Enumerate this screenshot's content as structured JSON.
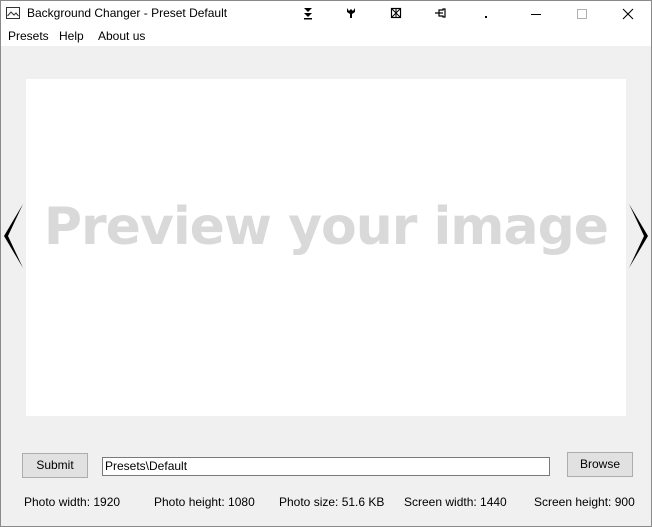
{
  "window": {
    "title": "Background Changer - Preset Default"
  },
  "titlebar_icons": [
    "double-chevron-down-icon",
    "wrench-icon",
    "grid-icon",
    "pin-icon",
    "dot-icon"
  ],
  "menu": {
    "items": [
      {
        "label": "Presets"
      },
      {
        "label": "Help"
      },
      {
        "label": "About us"
      }
    ]
  },
  "preview": {
    "placeholder": "Preview your image"
  },
  "controls": {
    "submit_label": "Submit",
    "path_value": "Presets\\Default",
    "browse_label": "Browse"
  },
  "status": {
    "photo_width": "Photo width: 1920",
    "photo_height": "Photo height: 1080",
    "photo_size": "Photo size: 51.6 KB",
    "screen_width": "Screen width: 1440",
    "screen_height": "Screen height: 900"
  },
  "colors": {
    "window_bg": "#f0f0f0",
    "preview_bg": "#ffffff",
    "placeholder_text": "#d9d9d9",
    "button_bg": "#e1e1e1"
  }
}
